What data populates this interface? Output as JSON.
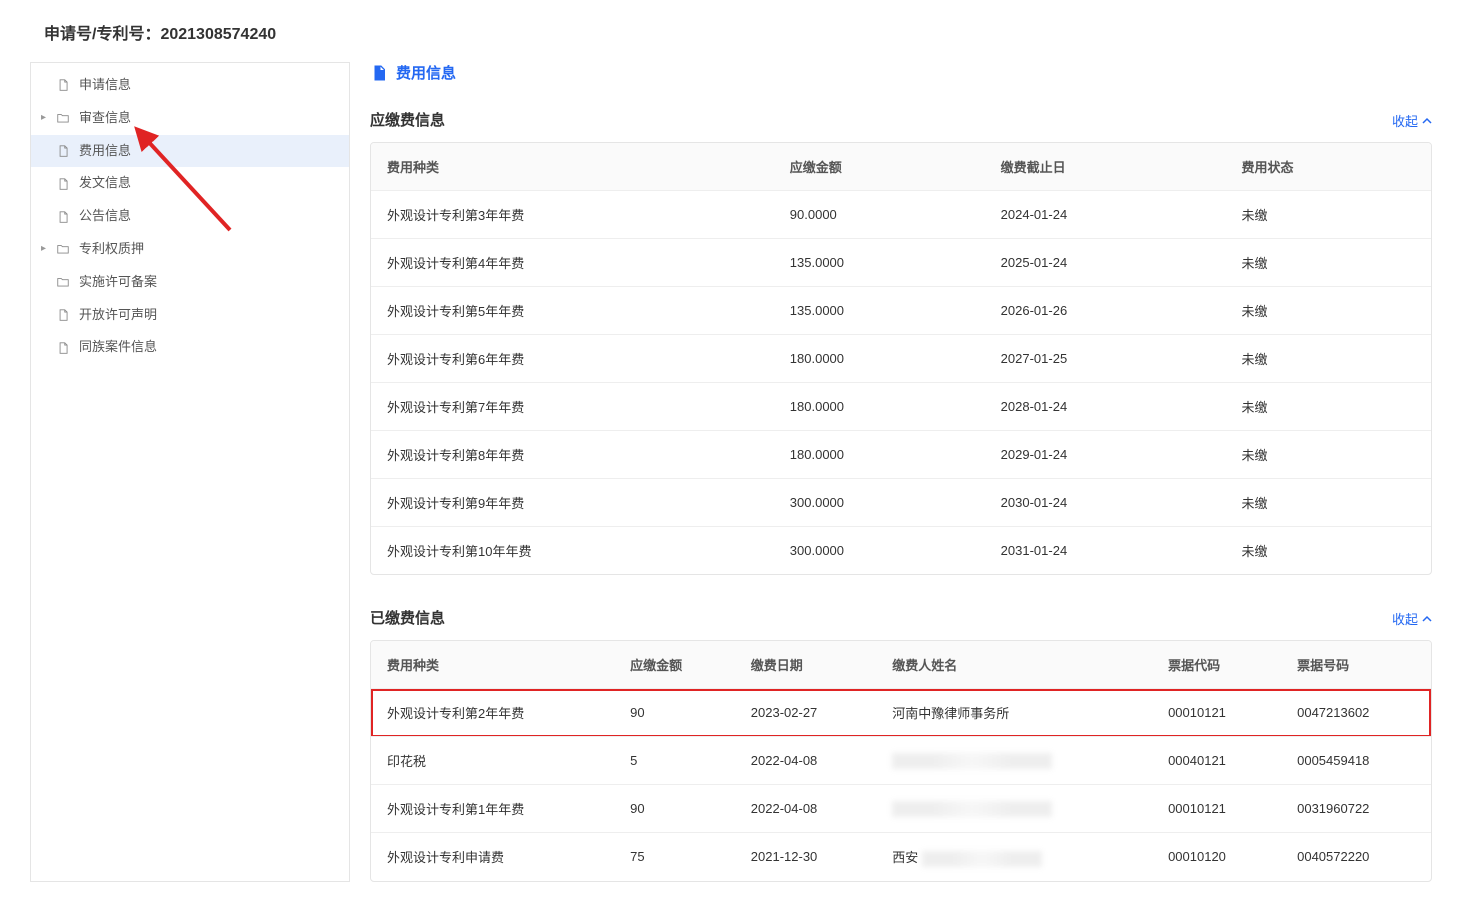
{
  "header": {
    "title_prefix": "申请号/专利号：",
    "patent_no": "2021308574240"
  },
  "sidebar": {
    "items": [
      {
        "label": "申请信息",
        "icon": "file",
        "expandable": false
      },
      {
        "label": "审查信息",
        "icon": "folder",
        "expandable": true
      },
      {
        "label": "费用信息",
        "icon": "file",
        "expandable": false,
        "active": true
      },
      {
        "label": "发文信息",
        "icon": "file",
        "expandable": false
      },
      {
        "label": "公告信息",
        "icon": "file",
        "expandable": false
      },
      {
        "label": "专利权质押",
        "icon": "folder",
        "expandable": true
      },
      {
        "label": "实施许可备案",
        "icon": "folder",
        "expandable": false
      },
      {
        "label": "开放许可声明",
        "icon": "file",
        "expandable": false
      },
      {
        "label": "同族案件信息",
        "icon": "file",
        "expandable": false
      }
    ]
  },
  "main": {
    "section_title": "费用信息",
    "collapse_label": "收起",
    "due_panel": {
      "title": "应缴费信息",
      "columns": [
        "费用种类",
        "应缴金额",
        "缴费截止日",
        "费用状态"
      ],
      "rows": [
        {
          "type": "外观设计专利第3年年费",
          "amount": "90.0000",
          "deadline": "2024-01-24",
          "status": "未缴"
        },
        {
          "type": "外观设计专利第4年年费",
          "amount": "135.0000",
          "deadline": "2025-01-24",
          "status": "未缴"
        },
        {
          "type": "外观设计专利第5年年费",
          "amount": "135.0000",
          "deadline": "2026-01-26",
          "status": "未缴"
        },
        {
          "type": "外观设计专利第6年年费",
          "amount": "180.0000",
          "deadline": "2027-01-25",
          "status": "未缴"
        },
        {
          "type": "外观设计专利第7年年费",
          "amount": "180.0000",
          "deadline": "2028-01-24",
          "status": "未缴"
        },
        {
          "type": "外观设计专利第8年年费",
          "amount": "180.0000",
          "deadline": "2029-01-24",
          "status": "未缴"
        },
        {
          "type": "外观设计专利第9年年费",
          "amount": "300.0000",
          "deadline": "2030-01-24",
          "status": "未缴"
        },
        {
          "type": "外观设计专利第10年年费",
          "amount": "300.0000",
          "deadline": "2031-01-24",
          "status": "未缴"
        }
      ]
    },
    "paid_panel": {
      "title": "已缴费信息",
      "columns": [
        "费用种类",
        "应缴金额",
        "缴费日期",
        "缴费人姓名",
        "票据代码",
        "票据号码"
      ],
      "rows": [
        {
          "type": "外观设计专利第2年年费",
          "amount": "90",
          "date": "2023-02-27",
          "payer": "河南中豫律师事务所",
          "code": "00010121",
          "ticket": "0047213602",
          "highlight": true
        },
        {
          "type": "印花税",
          "amount": "5",
          "date": "2022-04-08",
          "payer": "",
          "code": "00040121",
          "ticket": "0005459418"
        },
        {
          "type": "外观设计专利第1年年费",
          "amount": "90",
          "date": "2022-04-08",
          "payer": "",
          "code": "00010121",
          "ticket": "0031960722"
        },
        {
          "type": "外观设计专利申请费",
          "amount": "75",
          "date": "2021-12-30",
          "payer": "西安",
          "code": "00010120",
          "ticket": "0040572220"
        }
      ]
    }
  }
}
